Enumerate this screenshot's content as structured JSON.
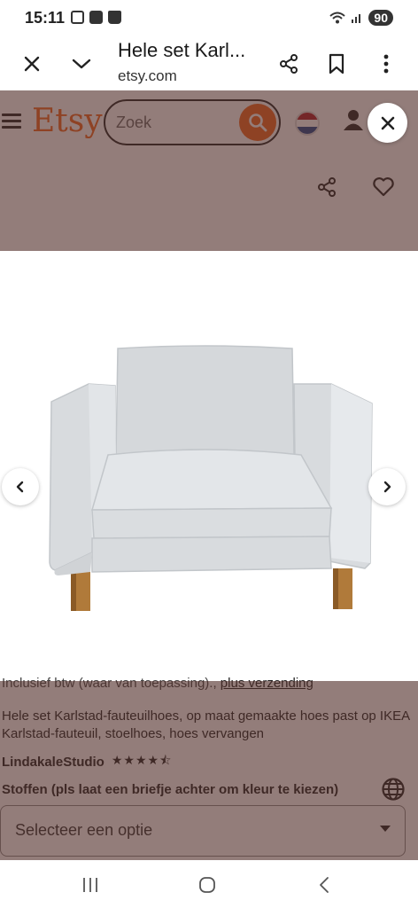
{
  "status_bar": {
    "time": "15:11",
    "battery": "90"
  },
  "browser": {
    "title": "Hele set Karl...",
    "url": "etsy.com"
  },
  "etsy": {
    "logo": "Etsy",
    "search_placeholder": "Zoek"
  },
  "listing": {
    "tax_text": "Inclusief btw (waar van toepassing)., ",
    "shipping_link": "plus verzending",
    "title": "Hele set Karlstad-fauteuilhoes, op maat gemaakte hoes past op IKEA Karlstad-fauteuil, stoelhoes, hoes vervangen",
    "shop_name": "LindakaleStudio",
    "rating_stars": "★★★★⯪",
    "rating": 4.5,
    "variation_label": "Stoffen (pls laat een briefje achter om kleur te kiezen)",
    "variation_selected": "Selecteer een optie"
  },
  "colors": {
    "brand": "#f1641e",
    "overlay": "#502d28"
  }
}
